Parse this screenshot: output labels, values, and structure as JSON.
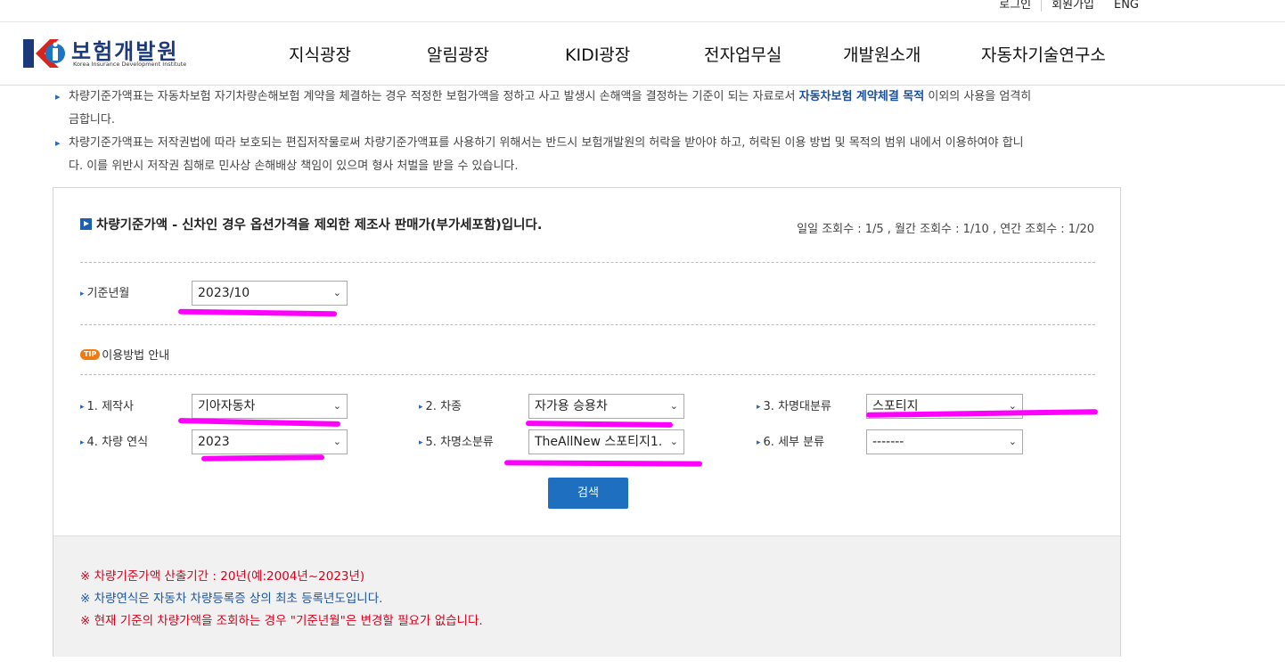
{
  "top_links": [
    "로그인",
    "회원가입",
    "ENG"
  ],
  "logo": {
    "name": "보험개발원",
    "subtitle": "Korea Insurance Development Institute",
    "mark": "ki"
  },
  "nav": [
    "지식광장",
    "알림광장",
    "KIDI광장",
    "전자업무실",
    "개발원소개",
    "자동차기술연구소"
  ],
  "notices": [
    {
      "pre": "차량기준가액표는 자동차보험 자기차량손해보험 계약을 체결하는 경우 적정한 보험가액을 정하고 사고 발생시 손해액을 결정하는 기준이 되는 자료로서 ",
      "highlight": "자동차보험 계약체결 목적",
      "post": " 이외의 사용을 엄격히",
      "line2": "금합니다."
    },
    {
      "pre": "차량기준가액표는 저작권법에 따라 보호되는 편집저작물로써 차량기준가액표를 사용하기 위해서는 반드시 보험개발원의 허락을 받아야 하고, 허락된 이용 방법 및 목적의 범위 내에서 이용하여야 합니",
      "line2": "다. 이를 위반시 저작권 침해로 민사상 손해배상 책임이 있으며 형사 처벌을 받을 수 있습니다."
    }
  ],
  "panel": {
    "title": "차량기준가액 - 신차인 경우 옵션가격을 제외한 제조사 판매가(부가세포함)입니다.",
    "counts": "일일 조회수 : 1/5 , 월간 조회수 : 1/10 , 연간 조회수 : 1/20",
    "base_month": {
      "label": "기준년월",
      "value": "2023/10"
    },
    "tip_badge": "TIP",
    "tip_text": "이용방법 안내",
    "fields": [
      {
        "label": "1. 제작사",
        "value": "기아자동차"
      },
      {
        "label": "2. 차종",
        "value": "자가용 승용차"
      },
      {
        "label": "3. 차명대분류",
        "value": "스포티지"
      },
      {
        "label": "4. 차량 연식",
        "value": "2023"
      },
      {
        "label": "5. 차명소분류",
        "value": "TheAllNew 스포티지1."
      },
      {
        "label": "6. 세부 분류",
        "value": "-------"
      }
    ],
    "search_button": "검색",
    "notes": [
      {
        "text": "※ 차량기준가액 산출기간 : 20년(예:2004년~2023년)",
        "color": "#d6001c"
      },
      {
        "text": "※ 차량연식은 자동차 차량등록증 상의 최초 등록년도입니다.",
        "color": "#1a56a0"
      },
      {
        "text": "※ 현재 기준의 차량가액을 조회하는 경우 \"기준년월\"은 변경할 필요가 없습니다.",
        "color": "#d6001c"
      }
    ]
  },
  "colors": {
    "accent": "#1f6fc1",
    "annotation": "#ff00ff",
    "logo": "#1c3a7a"
  }
}
